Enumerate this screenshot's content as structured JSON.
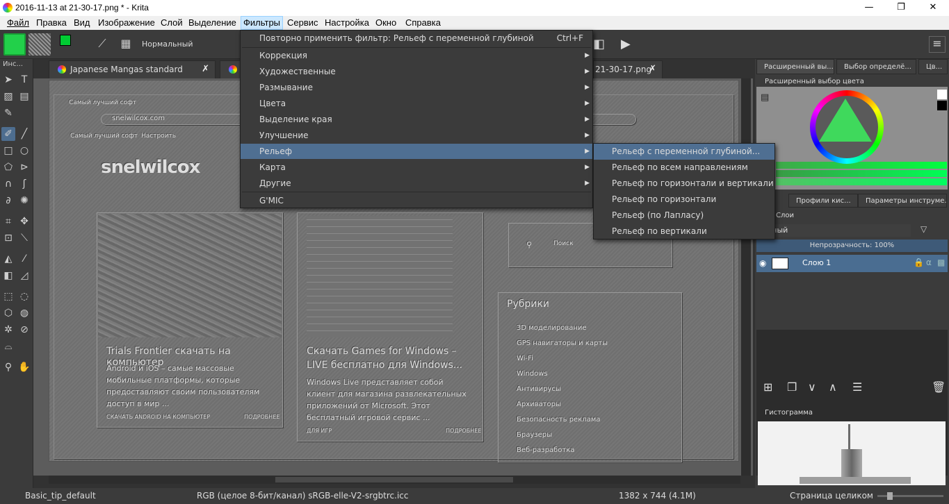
{
  "window": {
    "title": "2016-11-13 at 21-30-17.png * - Krita",
    "buttons": {
      "minimize": "—",
      "maximize": "❐",
      "close": "✕"
    }
  },
  "menubar": {
    "items": [
      "Файл",
      "Правка",
      "Вид",
      "Изображение",
      "Слой",
      "Выделение",
      "Фильтры",
      "Сервис",
      "Настройка",
      "Окно",
      "Справка"
    ],
    "active": "Фильтры"
  },
  "toolbar": {
    "blend_mode": "Нормальный"
  },
  "toolbox": {
    "title": "Инс..."
  },
  "tabs": [
    {
      "label": "Japanese Mangas standard template"
    },
    {
      "label": "21-30-17.png"
    }
  ],
  "filter_menu": {
    "reapply": {
      "label": "Повторно применить фильтр: Рельеф с переменной глубиной",
      "shortcut": "Ctrl+F"
    },
    "items": [
      "Коррекция",
      "Художественные",
      "Размывание",
      "Цвета",
      "Выделение края",
      "Улучшение",
      "Рельеф",
      "Карта",
      "Другие"
    ],
    "selected": "Рельеф",
    "gmic": "G'MIC"
  },
  "emboss_submenu": {
    "items": [
      "Рельеф с переменной глубиной...",
      "Рельеф по всем направлениям",
      "Рельеф по горизонтали и вертикали",
      "Рельеф по горизонтали",
      "Рельеф (по Лапласу)",
      "Рельеф по вертикали"
    ],
    "selected": "Рельеф с переменной глубиной..."
  },
  "right_dock": {
    "top_tabs": [
      "Расширенный вы...",
      "Выбор определё...",
      "Цв..."
    ],
    "color_selector_title": "Расширенный выбор цвета",
    "mid_tabs": [
      "Профили кис...",
      "Параметры инструме..."
    ],
    "layers_title": "Слои",
    "layer_blend": "альный",
    "opacity": "Непрозрачность:  100%",
    "layer_name": "Слою 1",
    "histogram_title": "Гистограмма"
  },
  "canvas_content": {
    "browser_tab": "Самый лучший софт",
    "url": "snelwilcox.com",
    "bookmark": "Самый лучший софт",
    "bookmark2": "Настроить",
    "logo": "snelwilcox",
    "card1_title": "Trials Frontier скачать на компьютер",
    "card1_text": "Android и iOS – самые массовые мобильные платформы, которые предоставляют своим пользователям доступ в мир ...",
    "card1_footer": "СКАЧАТЬ ANDROID НА КОМПЬЮТЕР",
    "card1_more": "ПОДРОБНЕЕ",
    "card2_title": "Скачать Games for Windows – LIVE бесплатно для Windows...",
    "card2_text": "Windows Live представляет собой клиент для магазина развлекательных приложений от Microsoft. Этот бесплатный игровой сервис ...",
    "card2_footer": "ДЛЯ ИГР",
    "card2_more": "ПОДРОБНЕЕ",
    "search_label": "Поиск",
    "rubrics_title": "Рубрики",
    "rubrics": [
      "3D моделирование",
      "GPS навигаторы и карты",
      "Wi-Fi",
      "Windows",
      "Антивирусы",
      "Архиваторы",
      "Безопасность реклама",
      "Браузеры",
      "Веб-разработка"
    ]
  },
  "statusbar": {
    "brush": "Basic_tip_default",
    "colorspace": "RGB (целое 8-бит/канал)  sRGB-elle-V2-srgbtrc.icc",
    "size": "1382 x 744 (4.1M)",
    "zoom": "Страница целиком"
  },
  "colors": {
    "accent": "#4f6f92",
    "fg_color": "#00cc33",
    "bg_color": "#ffffff"
  }
}
